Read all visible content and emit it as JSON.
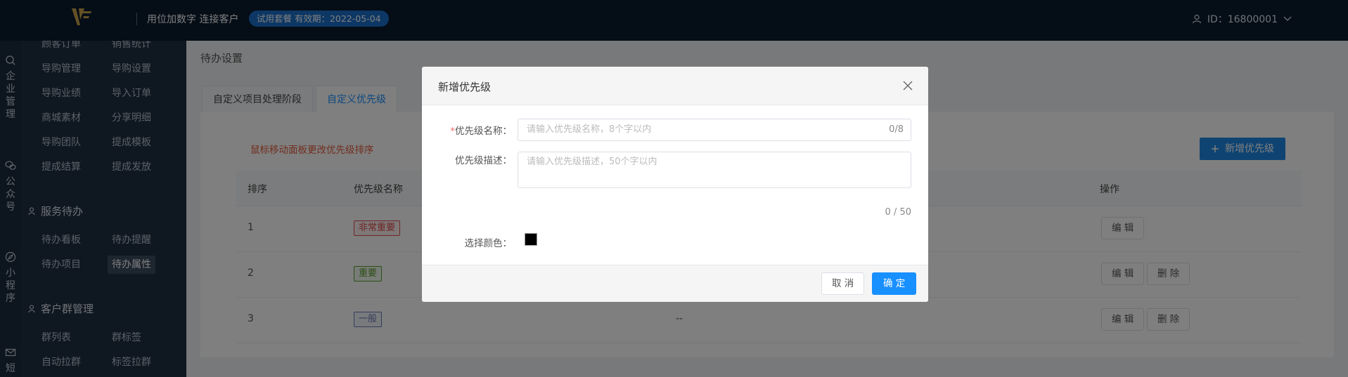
{
  "header": {
    "brand": "用位加数字 连接客户",
    "trial_badge": "试用套餐  有效期：2022-05-04",
    "user_id": "ID：16800001"
  },
  "rail": [
    {
      "icon": "enterprise-icon",
      "label": "企业管理"
    },
    {
      "icon": "wechat-icon",
      "label": "公众号"
    },
    {
      "icon": "compass-icon",
      "label": "小程序"
    },
    {
      "icon": "mail-icon",
      "label": "短"
    }
  ],
  "submenu": {
    "top_items": [
      "顾客订单",
      "销售统计",
      "导购管理",
      "导购设置",
      "导购业绩",
      "导入订单",
      "商城素材",
      "分享明细",
      "导购团队",
      "提成模板",
      "提成结算",
      "提成发放"
    ],
    "group_service": "服务待办",
    "service_items": [
      "待办看板",
      "待办提醒",
      "待办项目",
      "待办属性"
    ],
    "group_customer": "客户群管理",
    "customer_items": [
      "群列表",
      "群标签",
      "自动拉群",
      "标签拉群"
    ]
  },
  "main": {
    "breadcrumb": "待办设置",
    "tabs": [
      "自定义项目处理阶段",
      "自定义优先级"
    ],
    "hint": "鼠标移动面板更改优先级排序",
    "add_button": "新增优先级",
    "table": {
      "headers": [
        "排序",
        "优先级名称",
        "操作"
      ],
      "rows": [
        {
          "order": "1",
          "name": "非常重要",
          "color": "#e04a4a",
          "desc": "",
          "actions": [
            "编 辑"
          ]
        },
        {
          "order": "2",
          "name": "重要",
          "color": "#5a9e2f",
          "desc": "",
          "actions": [
            "编 辑",
            "删 除"
          ]
        },
        {
          "order": "3",
          "name": "一般",
          "color": "#6b7bb3",
          "desc": "--",
          "actions": [
            "编 辑",
            "删 除"
          ]
        }
      ]
    }
  },
  "modal": {
    "title": "新增优先级",
    "name_label": "优先级名称：",
    "name_required_mark": "*",
    "name_placeholder": "请输入优先级名称，8个字以内",
    "name_counter": "0/8",
    "desc_label": "优先级描述：",
    "desc_placeholder": "请输入优先级描述，50个字以内",
    "desc_counter": "0 / 50",
    "color_label": "选择颜色：",
    "selected_color": "#000000",
    "cancel_button": "取 消",
    "ok_button": "确 定"
  }
}
